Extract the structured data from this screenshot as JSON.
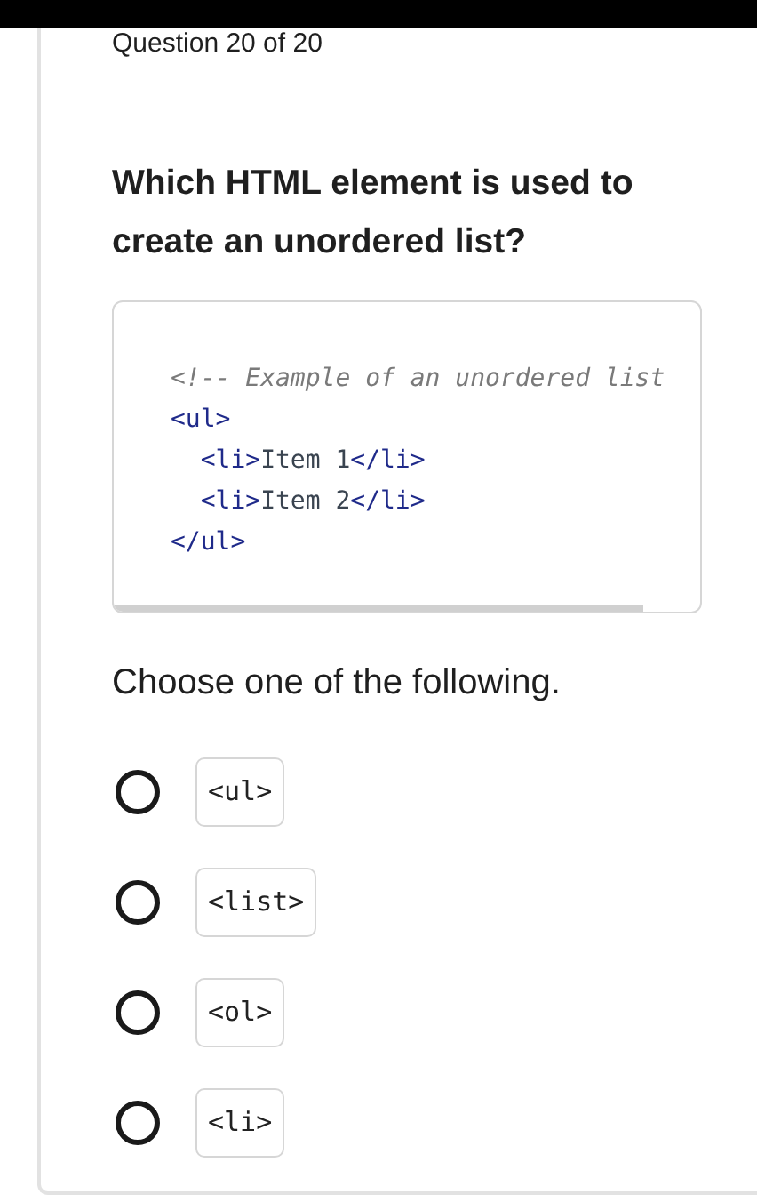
{
  "progress": "Question 20 of 20",
  "question": "Which HTML element is used to create an unordered list?",
  "code_lines": [
    [
      {
        "kind": "comment",
        "text": "<!-- Example of an unordered list"
      }
    ],
    {
      "tokens": [
        {
          "kind": "tag",
          "text": "<ul>"
        }
      ],
      "children": [
        {
          "tokens": [
            {
              "kind": "tag",
              "text": "<li>"
            },
            {
              "kind": "plain",
              "text": "Item 1"
            },
            {
              "kind": "tag",
              "text": "</li>"
            }
          ]
        },
        {
          "tokens": [
            {
              "kind": "tag",
              "text": "<li>"
            },
            {
              "kind": "plain",
              "text": "Item 2"
            },
            {
              "kind": "tag",
              "text": "</li>"
            }
          ]
        }
      ]
    },
    [
      {
        "kind": "tag",
        "text": "</ul>"
      }
    ]
  ],
  "prompt": "Choose one of the following.",
  "options": [
    {
      "label": "<ul>",
      "selected": false
    },
    {
      "label": "<list>",
      "selected": false
    },
    {
      "label": "<ol>",
      "selected": false
    },
    {
      "label": "<li>",
      "selected": false
    }
  ]
}
